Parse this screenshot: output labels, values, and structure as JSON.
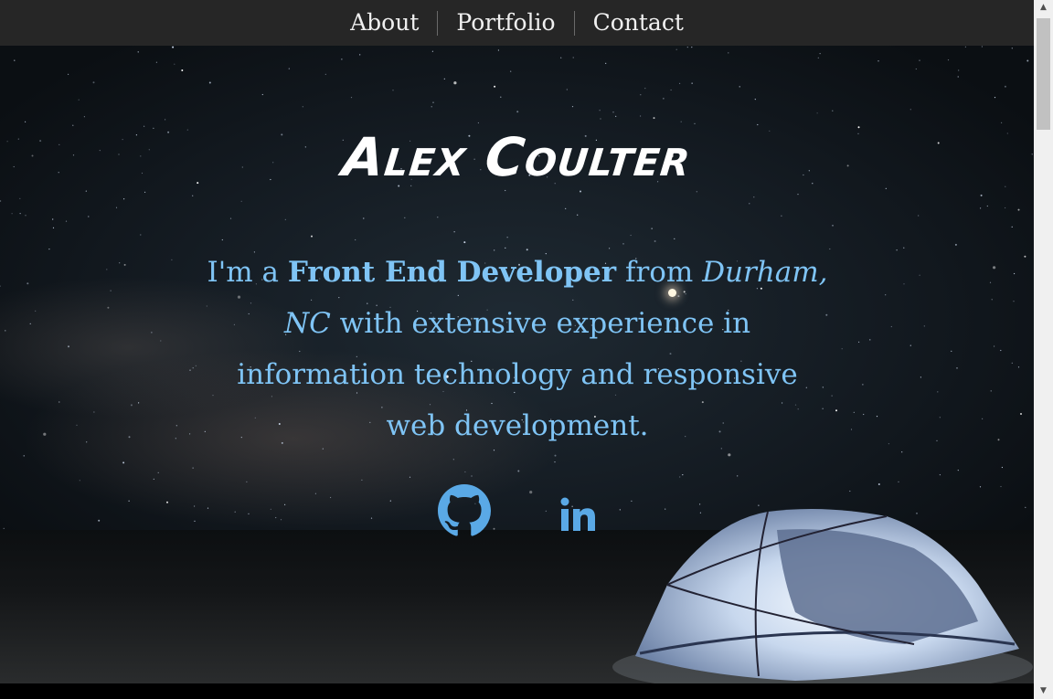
{
  "nav": {
    "about": "About",
    "portfolio": "Portfolio",
    "contact": "Contact"
  },
  "hero": {
    "title": "Alex Coulter",
    "intro": {
      "prefix": "I'm a ",
      "role": "Front End Developer",
      "from": " from ",
      "location": "Durham, NC",
      "suffix": " with extensive experience in information technology and responsive web development."
    }
  },
  "social": {
    "github_icon": "github-icon",
    "linkedin_icon": "linkedin-icon"
  },
  "colors": {
    "nav_bg": "#262626",
    "accent_text": "#7fc4f5",
    "icon": "#5aa9e6"
  },
  "scrollbar": {
    "up_arrow": "▲",
    "down_arrow": "▼"
  }
}
